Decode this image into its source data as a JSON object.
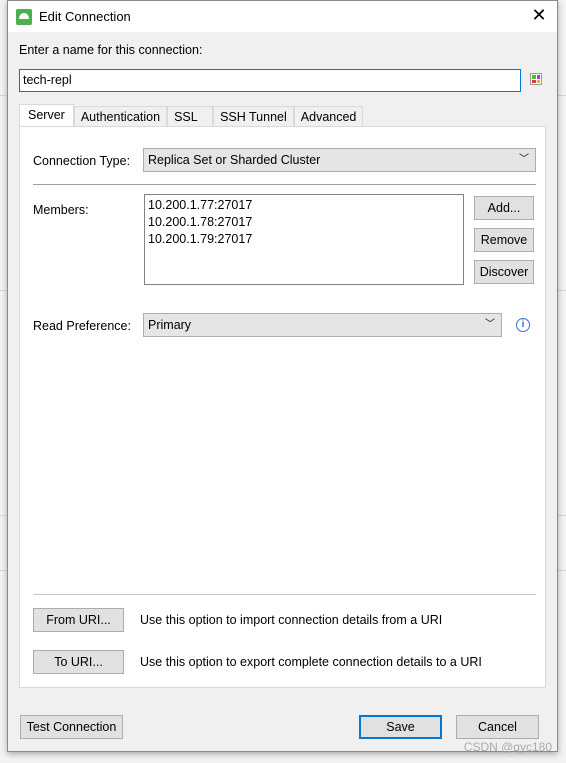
{
  "dialog": {
    "title": "Edit Connection",
    "name_label": "Enter a name for this connection:",
    "name_value": "tech-repl"
  },
  "tabs": [
    "Server",
    "Authentication",
    "SSL",
    "SSH Tunnel",
    "Advanced"
  ],
  "server": {
    "connection_type_label": "Connection Type:",
    "connection_type_value": "Replica Set or Sharded Cluster",
    "members_label": "Members:",
    "members": [
      "10.200.1.77:27017",
      "10.200.1.78:27017",
      "10.200.1.79:27017"
    ],
    "add_label": "Add...",
    "remove_label": "Remove",
    "discover_label": "Discover",
    "read_pref_label": "Read Preference:",
    "read_pref_value": "Primary",
    "from_uri_label": "From URI...",
    "from_uri_desc": "Use this option to import connection details from a URI",
    "to_uri_label": "To URI...",
    "to_uri_desc": "Use this option to export complete connection details to a URI"
  },
  "footer": {
    "test_label": "Test Connection",
    "save_label": "Save",
    "cancel_label": "Cancel"
  },
  "watermark": "CSDN @qyc180",
  "colors": {
    "accent": "#0078d7",
    "app_icon": "#4caf50"
  }
}
